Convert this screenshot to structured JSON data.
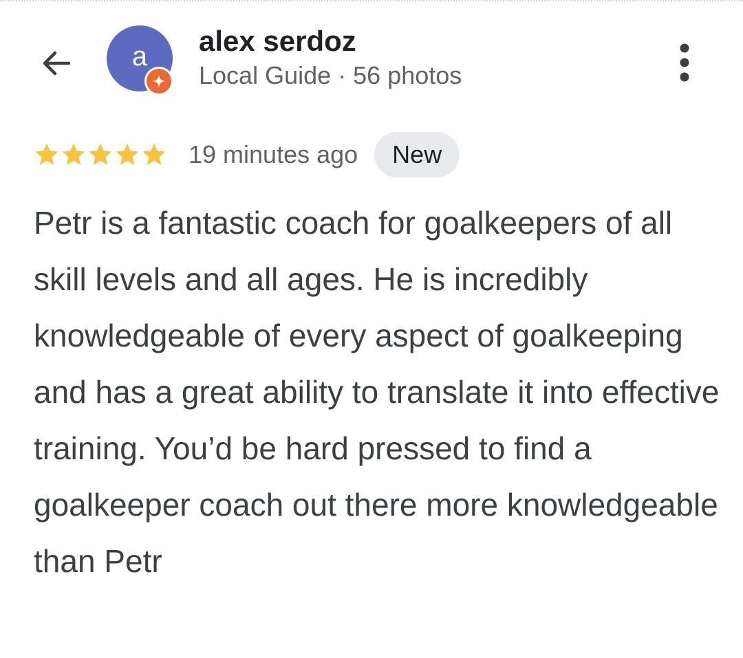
{
  "header": {
    "back_icon": "arrow-left-icon",
    "more_icon": "more-vert-icon"
  },
  "reviewer": {
    "avatar_letter": "a",
    "avatar_color": "#5c6bc0",
    "badge_icon": "local-guide-badge-icon",
    "badge_color": "#ea6a35",
    "name": "alex serdoz",
    "meta": "Local Guide · 56 photos"
  },
  "review": {
    "rating": 5,
    "rating_max": 5,
    "star_color": "#f6c344",
    "time_ago": "19 minutes ago",
    "badge": "New",
    "text": "Petr is a fantastic coach for goalkeepers of all skill levels and all ages. He is incredibly knowledgeable of every aspect of goalkeeping and has a great ability to translate it into effective training. You’d be hard pressed to find a goalkeeper coach out there more knowledgeable than Petr"
  }
}
